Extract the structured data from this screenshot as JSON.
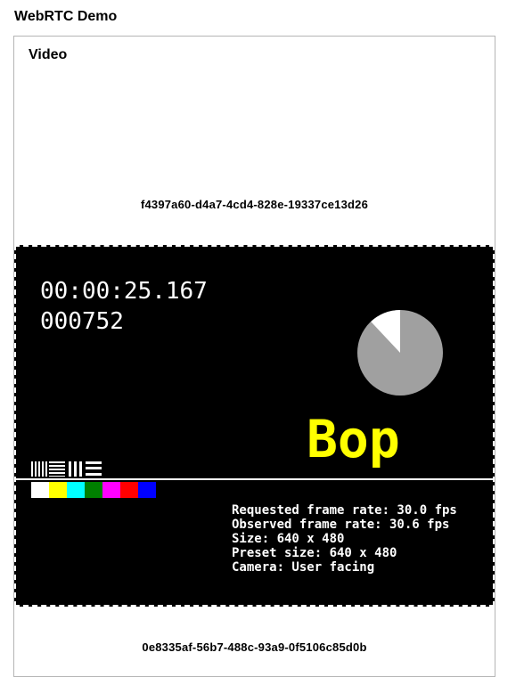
{
  "app": {
    "title": "WebRTC Demo"
  },
  "panel": {
    "title": "Video"
  },
  "streams": [
    {
      "id": "f4397a60-d4a7-4cd4-828e-19337ce13d26",
      "video": {
        "timecode": "00:00:25.167",
        "frame_number": "000752",
        "label_word": "Bop",
        "pie_fraction_remaining": 0.88,
        "color_bars": [
          "#ffffff",
          "#ffff00",
          "#00ffff",
          "#008000",
          "#ff00ff",
          "#ff0000",
          "#0000ff"
        ],
        "stats": [
          "Requested frame rate: 30.0 fps",
          "Observed frame rate: 30.6 fps",
          "Size: 640 x 480",
          "Preset size: 640 x 480",
          "Camera: User facing"
        ]
      }
    },
    {
      "id": "0e8335af-56b7-488c-93a9-0f5106c85d0b"
    }
  ],
  "colors": {
    "label_word": "#ffff00",
    "pie": "#a0a0a0",
    "pie_slice": "#ffffff"
  }
}
